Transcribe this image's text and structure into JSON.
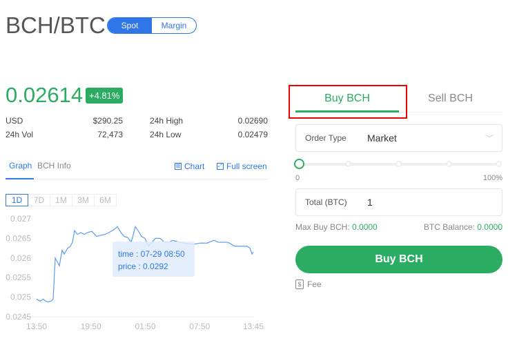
{
  "header": {
    "pair": "BCH/BTC",
    "modes": [
      "Spot",
      "Margin"
    ],
    "active_mode": "Spot"
  },
  "ticker": {
    "price": "0.02614",
    "change": "+4.81%",
    "stats": [
      {
        "label": "USD",
        "value": "$290.25"
      },
      {
        "label": "24h High",
        "value": "0.02690"
      },
      {
        "label": "24h Vol",
        "value": "72,473"
      },
      {
        "label": "24h Low",
        "value": "0.02479"
      }
    ]
  },
  "graph_tabs": {
    "graph": "Graph",
    "info": "BCH Info",
    "chart": "Chart",
    "fullscreen": "Full screen"
  },
  "ranges": [
    "1D",
    "7D",
    "1M",
    "3M",
    "6M"
  ],
  "tooltip": {
    "time": "time : 07-29 08:50",
    "price": "price : 0.0292"
  },
  "chart_data": {
    "type": "line",
    "x_unit": "hours since 13:50",
    "ylim": [
      0.0245,
      0.027
    ],
    "yticks": [
      "0.027",
      "0.0265",
      "0.026",
      "0.0255",
      "0.025",
      "0.0245"
    ],
    "xticks": [
      {
        "label": "13:50",
        "t": 0
      },
      {
        "label": "19:50",
        "t": 6
      },
      {
        "label": "01:50",
        "t": 12
      },
      {
        "label": "07:50",
        "t": 18
      },
      {
        "label": "13:45",
        "t": 23.92
      }
    ],
    "series": [
      {
        "name": "price",
        "color": "#5b9bf0",
        "points": [
          [
            0,
            0.02495
          ],
          [
            0.38,
            0.0249
          ],
          [
            0.76,
            0.02495
          ],
          [
            0.99,
            0.0249
          ],
          [
            1.3,
            0.02488
          ],
          [
            1.6,
            0.0249
          ],
          [
            1.83,
            0.02495
          ],
          [
            2.06,
            0.026
          ],
          [
            2.29,
            0.0259
          ],
          [
            2.51,
            0.0258
          ],
          [
            2.82,
            0.0262
          ],
          [
            3.05,
            0.0261
          ],
          [
            3.43,
            0.02625
          ],
          [
            3.73,
            0.0263
          ],
          [
            3.96,
            0.0264
          ],
          [
            4.19,
            0.0267
          ],
          [
            4.5,
            0.0266
          ],
          [
            4.88,
            0.02665
          ],
          [
            5.26,
            0.0266
          ],
          [
            5.64,
            0.02665
          ],
          [
            6.1,
            0.02668
          ],
          [
            6.63,
            0.02655
          ],
          [
            7.09,
            0.02658
          ],
          [
            7.54,
            0.0266
          ],
          [
            8.0,
            0.02665
          ],
          [
            8.53,
            0.02672
          ],
          [
            8.92,
            0.0268
          ],
          [
            9.3,
            0.02665
          ],
          [
            9.68,
            0.02655
          ],
          [
            10.06,
            0.02652
          ],
          [
            10.44,
            0.0264
          ],
          [
            10.9,
            0.0268
          ],
          [
            11.2,
            0.0267
          ],
          [
            11.58,
            0.02655
          ],
          [
            11.96,
            0.0265
          ],
          [
            12.34,
            0.0263
          ],
          [
            12.73,
            0.0264
          ],
          [
            13.11,
            0.0265
          ],
          [
            13.64,
            0.0265
          ],
          [
            14.1,
            0.0264
          ],
          [
            14.63,
            0.0264
          ],
          [
            15.01,
            0.02645
          ],
          [
            15.77,
            0.0264
          ],
          [
            16.54,
            0.02637
          ],
          [
            17.3,
            0.02635
          ],
          [
            18.06,
            0.02638
          ],
          [
            18.82,
            0.02638
          ],
          [
            19.58,
            0.02645
          ],
          [
            20.04,
            0.0264
          ],
          [
            20.73,
            0.0264
          ],
          [
            21.11,
            0.0264
          ],
          [
            21.87,
            0.0263
          ],
          [
            22.63,
            0.0263
          ],
          [
            23.24,
            0.0263
          ],
          [
            23.55,
            0.02625
          ],
          [
            23.77,
            0.0261
          ],
          [
            23.92,
            0.02615
          ]
        ]
      }
    ]
  },
  "order": {
    "buy_tab": "Buy BCH",
    "sell_tab": "Sell BCH",
    "order_type_label": "Order Type",
    "order_type": "Market",
    "slider_min": "0",
    "slider_max": "100%",
    "slider_value": 0,
    "total_label": "Total (BTC)",
    "total_value": "1",
    "max_buy_label": "Max Buy BCH:",
    "max_buy": "0.0000",
    "balance_label": "BTC Balance:",
    "balance": "0.0000",
    "submit": "Buy BCH",
    "fee": "Fee"
  }
}
